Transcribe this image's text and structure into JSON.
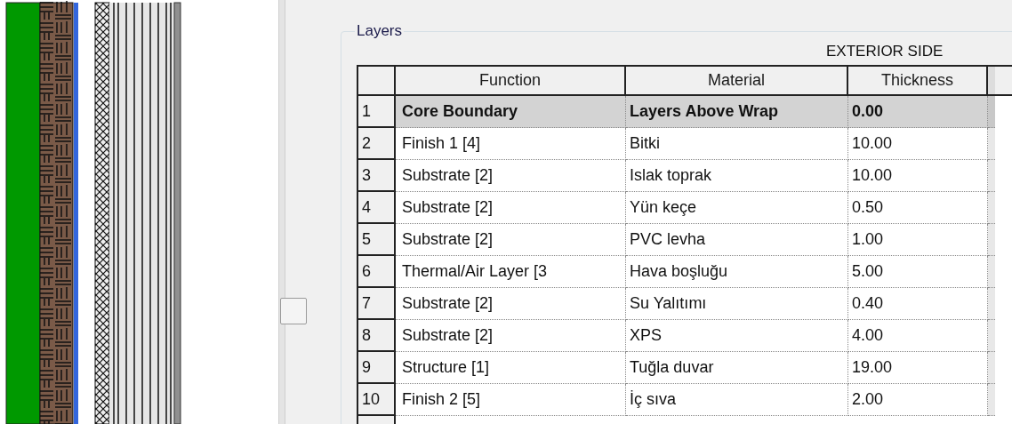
{
  "group_title": "Layers",
  "side_label": "EXTERIOR SIDE",
  "columns": [
    "Function",
    "Material",
    "Thickness"
  ],
  "rows": [
    {
      "number": "1",
      "kind": "boundary",
      "function": "Core Boundary",
      "material": "Layers Above Wrap",
      "thickness": "0.00"
    },
    {
      "number": "2",
      "kind": "layer",
      "function": "Finish 1 [4]",
      "material": "Bitki",
      "thickness": "10.00"
    },
    {
      "number": "3",
      "kind": "layer",
      "function": "Substrate [2]",
      "material": "Islak toprak",
      "thickness": "10.00"
    },
    {
      "number": "4",
      "kind": "layer",
      "function": "Substrate [2]",
      "material": "Yün keçe",
      "thickness": "0.50"
    },
    {
      "number": "5",
      "kind": "layer",
      "function": "Substrate [2]",
      "material": "PVC levha",
      "thickness": "1.00"
    },
    {
      "number": "6",
      "kind": "layer",
      "function": "Thermal/Air Layer [3",
      "material": "Hava boşluğu",
      "thickness": "5.00"
    },
    {
      "number": "7",
      "kind": "layer",
      "function": "Substrate [2]",
      "material": "Su Yalıtımı",
      "thickness": "0.40"
    },
    {
      "number": "8",
      "kind": "layer",
      "function": "Substrate [2]",
      "material": "XPS",
      "thickness": "4.00"
    },
    {
      "number": "9",
      "kind": "layer",
      "function": "Structure [1]",
      "material": "Tuğla duvar",
      "thickness": "19.00"
    },
    {
      "number": "10",
      "kind": "layer",
      "function": "Finish 2 [5]",
      "material": "İç sıva",
      "thickness": "2.00"
    }
  ]
}
